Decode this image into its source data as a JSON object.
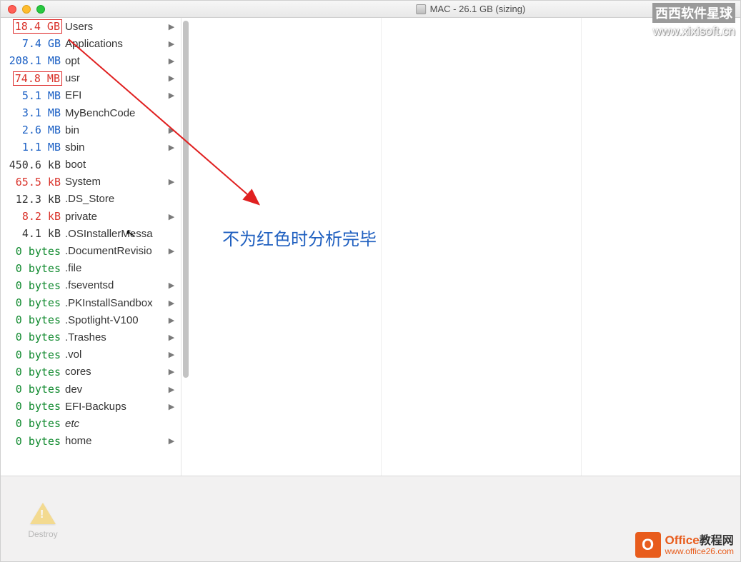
{
  "window": {
    "title": "MAC - 26.1 GB (sizing)"
  },
  "list": [
    {
      "size": "18.4 GB",
      "name": "Users",
      "color": "red",
      "arrow": true,
      "highlight": true
    },
    {
      "size": "7.4 GB",
      "name": "Applications",
      "color": "blue",
      "arrow": true
    },
    {
      "size": "208.1 MB",
      "name": "opt",
      "color": "blue",
      "arrow": true
    },
    {
      "size": "74.8 MB",
      "name": "usr",
      "color": "red",
      "arrow": true,
      "highlight": true
    },
    {
      "size": "5.1 MB",
      "name": "EFI",
      "color": "blue",
      "arrow": true
    },
    {
      "size": "3.1 MB",
      "name": "MyBenchCode",
      "color": "blue",
      "arrow": false
    },
    {
      "size": "2.6 MB",
      "name": "bin",
      "color": "blue",
      "arrow": true
    },
    {
      "size": "1.1 MB",
      "name": "sbin",
      "color": "blue",
      "arrow": true
    },
    {
      "size": "450.6 kB",
      "name": "boot",
      "color": "black",
      "arrow": false
    },
    {
      "size": "65.5 kB",
      "name": "System",
      "color": "red",
      "arrow": true
    },
    {
      "size": "12.3 kB",
      "name": ".DS_Store",
      "color": "black",
      "arrow": false
    },
    {
      "size": "8.2 kB",
      "name": "private",
      "color": "red",
      "arrow": true
    },
    {
      "size": "4.1 kB",
      "name": ".OSInstallerMessa",
      "color": "black",
      "arrow": false
    },
    {
      "size": "0 bytes",
      "name": ".DocumentRevisio",
      "color": "green",
      "arrow": true
    },
    {
      "size": "0 bytes",
      "name": ".file",
      "color": "green",
      "arrow": false
    },
    {
      "size": "0 bytes",
      "name": ".fseventsd",
      "color": "green",
      "arrow": true
    },
    {
      "size": "0 bytes",
      "name": ".PKInstallSandbox",
      "color": "green",
      "arrow": true
    },
    {
      "size": "0 bytes",
      "name": ".Spotlight-V100",
      "color": "green",
      "arrow": true
    },
    {
      "size": "0 bytes",
      "name": ".Trashes",
      "color": "green",
      "arrow": true
    },
    {
      "size": "0 bytes",
      "name": ".vol",
      "color": "green",
      "arrow": true
    },
    {
      "size": "0 bytes",
      "name": "cores",
      "color": "green",
      "arrow": true
    },
    {
      "size": "0 bytes",
      "name": "dev",
      "color": "green",
      "arrow": true
    },
    {
      "size": "0 bytes",
      "name": "EFI-Backups",
      "color": "green",
      "arrow": true
    },
    {
      "size": "0 bytes",
      "name": "etc",
      "color": "green",
      "arrow": false,
      "italic": true
    },
    {
      "size": "0 bytes",
      "name": "home",
      "color": "green",
      "arrow": true
    }
  ],
  "annotation": "不为红色时分析完毕",
  "footer": {
    "destroy_label": "Destroy"
  },
  "watermarks": {
    "top_cn": "西西软件星球",
    "top_url": "www.xixisoft.cn",
    "bottom_brand": "Office",
    "bottom_cn": "教程网",
    "bottom_url": "www.office26.com"
  }
}
